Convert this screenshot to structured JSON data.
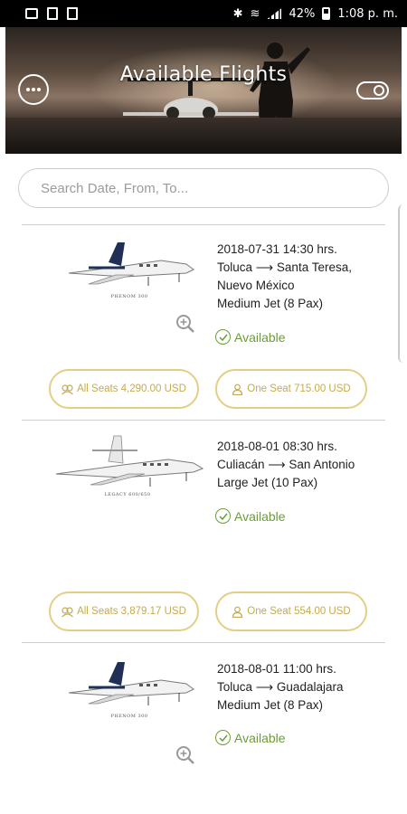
{
  "status_bar": {
    "battery": "42%",
    "time": "1:08 p. m."
  },
  "header": {
    "title": "Available Flights"
  },
  "search": {
    "placeholder": "Search Date, From, To..."
  },
  "flights": [
    {
      "jet_model": "PHENOM 300",
      "datetime": "2018-07-31 14:30 hrs.",
      "from": "Toluca",
      "to": "Santa Teresa,",
      "to_line2": "Nuevo México",
      "jet_type": "Medium Jet (8 Pax)",
      "status": "Available",
      "all_seats": "All Seats 4,290.00 USD",
      "one_seat": "One Seat 715.00 USD"
    },
    {
      "jet_model": "LEGACY 600/650",
      "datetime": "2018-08-01 08:30 hrs.",
      "from": "Culiacán",
      "to": "San Antonio",
      "jet_type": "Large Jet (10 Pax)",
      "status": "Available",
      "all_seats": "All Seats 3,879.17 USD",
      "one_seat": "One Seat 554.00 USD"
    },
    {
      "jet_model": "PHENOM 300",
      "datetime": "2018-08-01 11:00 hrs.",
      "from": "Toluca",
      "to": "Guadalajara",
      "jet_type": "Medium Jet (8 Pax)",
      "status": "Available"
    }
  ],
  "colors": {
    "accent_gold": "#e3cf83",
    "available_green": "#6d9c3a"
  }
}
